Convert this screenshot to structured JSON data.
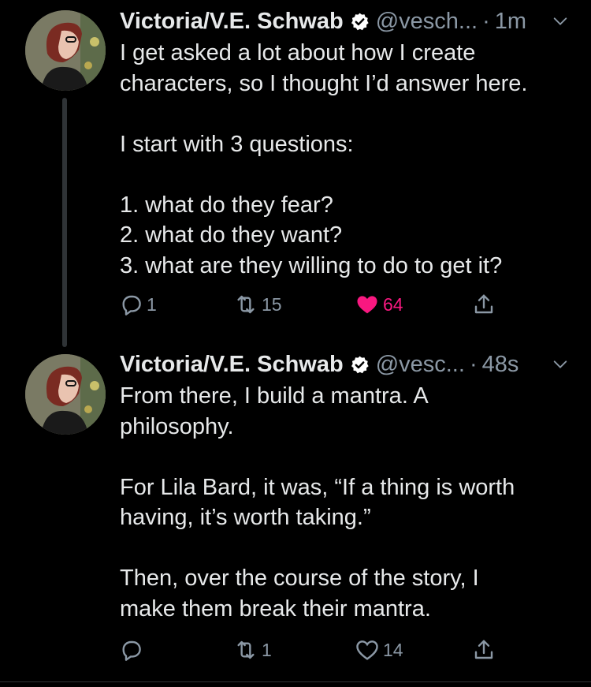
{
  "tweets": [
    {
      "author_name": "Victoria/V.E. Schwab",
      "handle": "@vesch...",
      "separator": "·",
      "time": "1m",
      "lines": [
        "I get asked a lot about how I create",
        "characters, so I thought I’d answer here.",
        "",
        "I start with 3 questions:",
        "",
        "1. what do they fear?",
        "2. what do they want?",
        "3. what are they willing to do to get it?"
      ],
      "replies": "1",
      "retweets": "15",
      "likes": "64",
      "liked": true
    },
    {
      "author_name": "Victoria/V.E. Schwab",
      "handle": "@vesc...",
      "separator": "·",
      "time": "48s",
      "lines": [
        "From there, I build a mantra. A",
        "philosophy.",
        "",
        "For Lila Bard, it was, “If a thing is worth",
        "having, it’s worth taking.”",
        "",
        "Then, over the course of the story, I",
        "make them break their mantra."
      ],
      "replies": "",
      "retweets": "1",
      "likes": "14",
      "liked": false
    }
  ],
  "colors": {
    "background": "#000000",
    "text": "#e7e9ea",
    "secondary": "#8b98a5",
    "verified": "#ffffff",
    "like": "#f91880"
  }
}
